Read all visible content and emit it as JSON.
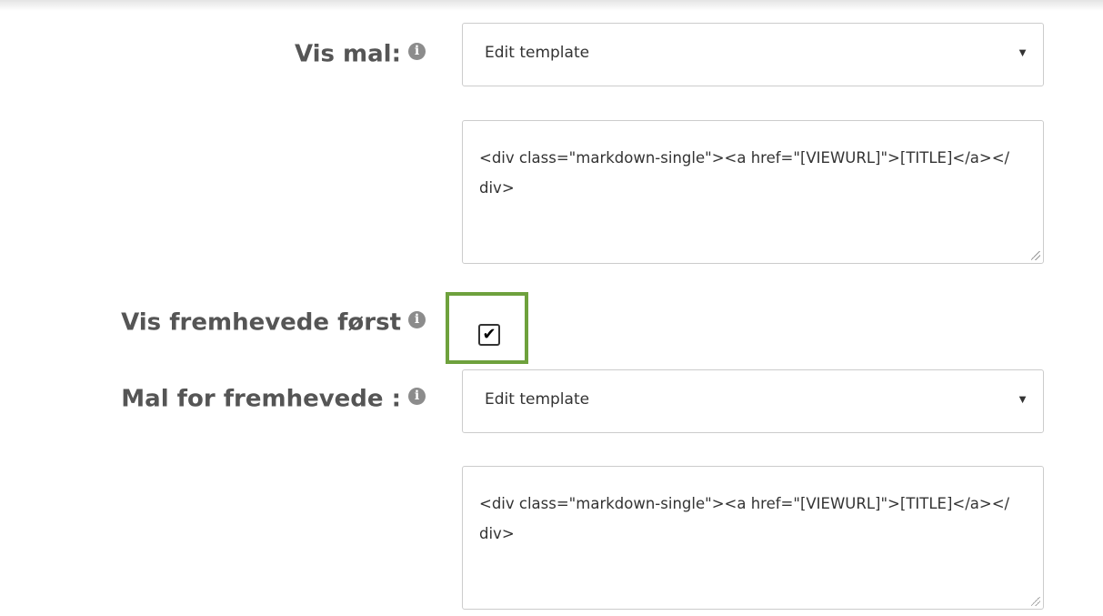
{
  "fields": {
    "view_template": {
      "label": "Vis mal:",
      "select_value": "Edit template",
      "textarea_value": "<div class=\"markdown-single\"><a href=\"[VIEWURL]\">[TITLE]</a></div>"
    },
    "show_featured_first": {
      "label": "Vis fremhevede først",
      "checked": true,
      "check_glyph": "✔"
    },
    "featured_template": {
      "label": "Mal for fremhevede :",
      "select_value": "Edit template",
      "textarea_value": "<div class=\"markdown-single\"><a href=\"[VIEWURL]\">[TITLE]</a></div>"
    }
  },
  "icons": {
    "info": "i",
    "caret": "▼"
  },
  "colors": {
    "label": "#555555",
    "highlight": "#6ea13d",
    "info_icon": "#8c8c8c"
  }
}
